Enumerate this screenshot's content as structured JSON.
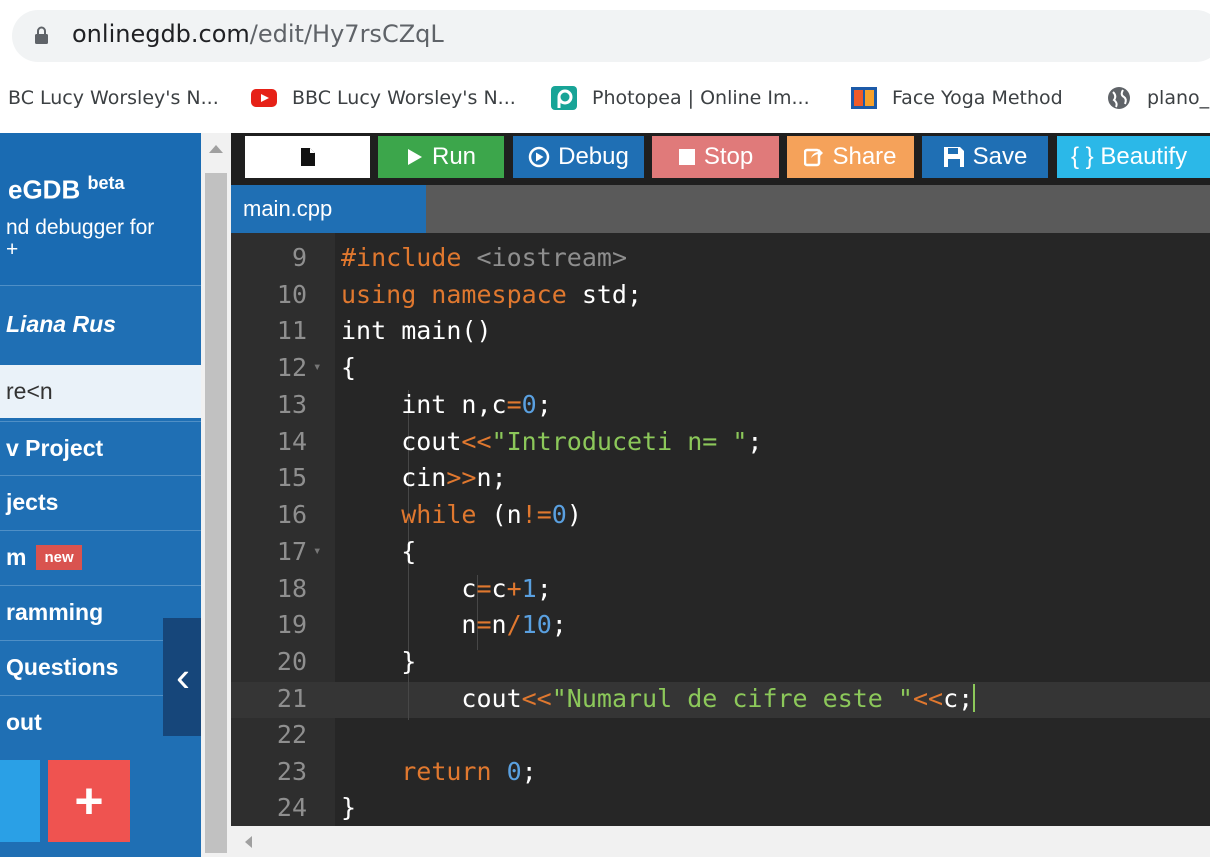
{
  "browser": {
    "url_host": "onlinegdb.com",
    "url_path": "/edit/Hy7rsCZqL",
    "bookmarks": [
      {
        "label": "BC Lucy Worsley's N...",
        "icon": "none"
      },
      {
        "label": "BBC Lucy Worsley's N...",
        "icon": "youtube-icon"
      },
      {
        "label": "Photopea | Online Im...",
        "icon": "photopea-icon"
      },
      {
        "label": "Face Yoga Method",
        "icon": "face-yoga-icon"
      },
      {
        "label": "plano_",
        "icon": "globe-icon"
      }
    ]
  },
  "sidebar": {
    "logo": "eGDB",
    "logo_sup": "beta",
    "tagline_1": "nd debugger for",
    "tagline_2": "+",
    "user": "Liana Rus",
    "current": "re<n",
    "items": [
      "v Project",
      "jects",
      "m",
      "ramming",
      "Questions",
      "out"
    ],
    "new_badge": "new",
    "collapse_icon": "‹",
    "plus_icon": "+"
  },
  "toolbar": {
    "run": "Run",
    "debug": "Debug",
    "stop": "Stop",
    "share": "Share",
    "save": "Save",
    "beautify": "{ } Beautify"
  },
  "tab": {
    "filename": "main.cpp"
  },
  "colors": {
    "run": "#3ca64b",
    "debug": "#1f6fb4",
    "stop": "#e07a7a",
    "share": "#f5a25a",
    "save": "#1f6fb4",
    "beautify": "#2bb8e8"
  },
  "editor": {
    "line_numbers": [
      "9",
      "10",
      "11",
      "12",
      "13",
      "14",
      "15",
      "16",
      "17",
      "18",
      "19",
      "20",
      "21",
      "22",
      "23",
      "24"
    ]
  }
}
